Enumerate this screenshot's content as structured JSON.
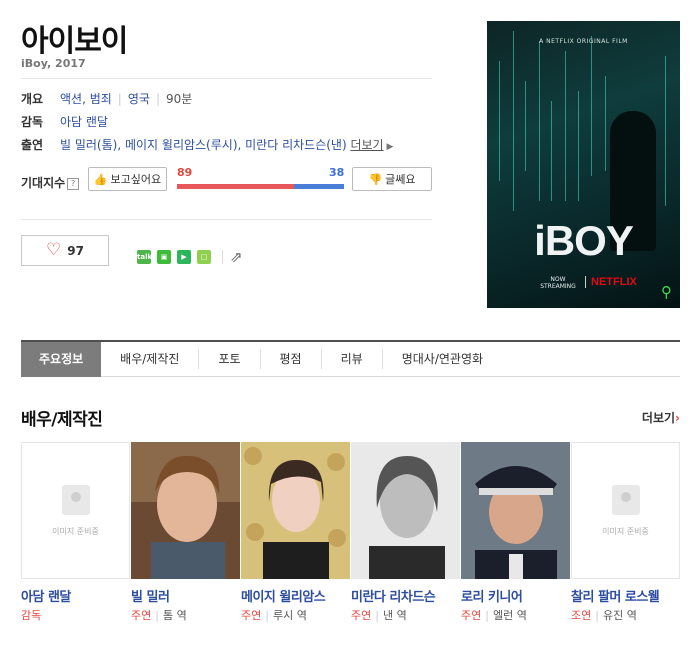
{
  "movie": {
    "title": "아이보이",
    "subtitle": "iBoy, 2017"
  },
  "info": {
    "overview_label": "개요",
    "genre": "액션, 범죄",
    "country": "영국",
    "runtime": "90분",
    "director_label": "감독",
    "director": "아담 랜달",
    "cast_label": "출연",
    "cast_list": "빌 밀러(톰), 메이지 윌리암스(루시), 미란다 리차드슨(낸)",
    "more_label": "더보기"
  },
  "expectation": {
    "label": "기대지수",
    "help": "?",
    "want_label": "보고싶어요",
    "no_label": "글쎄요",
    "want_count": "89",
    "no_count": "38",
    "want_ratio": 0.7
  },
  "like": {
    "count": "97"
  },
  "share": {
    "icons": [
      "kakaotalk-icon",
      "kakaostory-icon",
      "band-icon",
      "line-icon",
      "share-external-icon"
    ],
    "colors": [
      "#4cb748",
      "#3dbb3b",
      "#2db55d",
      "#8fd14f"
    ]
  },
  "poster": {
    "original_film": "A NETFLIX ORIGINAL FILM",
    "title": "iBOY",
    "now_streaming": "NOW STREAMING",
    "netflix": "NETFLIX"
  },
  "tabs": [
    "주요정보",
    "배우/제작진",
    "포토",
    "평점",
    "리뷰",
    "명대사/연관영화"
  ],
  "cast_section": {
    "title": "배우/제작진",
    "more_label": "더보기",
    "no_image_text": "이미지 준비중",
    "members": [
      {
        "name": "아담 랜달",
        "role": "감독",
        "character": ""
      },
      {
        "name": "빌 밀러",
        "role": "주연",
        "character": "톰 역"
      },
      {
        "name": "메이지 윌리암스",
        "role": "주연",
        "character": "루시 역"
      },
      {
        "name": "미란다 리차드슨",
        "role": "주연",
        "character": "낸 역"
      },
      {
        "name": "로리 키니어",
        "role": "주연",
        "character": "엘런 역"
      },
      {
        "name": "찰리 팔머 로스웰",
        "role": "조연",
        "character": "유진 역"
      }
    ]
  },
  "colors": {
    "accent_red": "#e3473f",
    "accent_blue": "#3b6fd6",
    "link_blue": "#2c4da0"
  }
}
